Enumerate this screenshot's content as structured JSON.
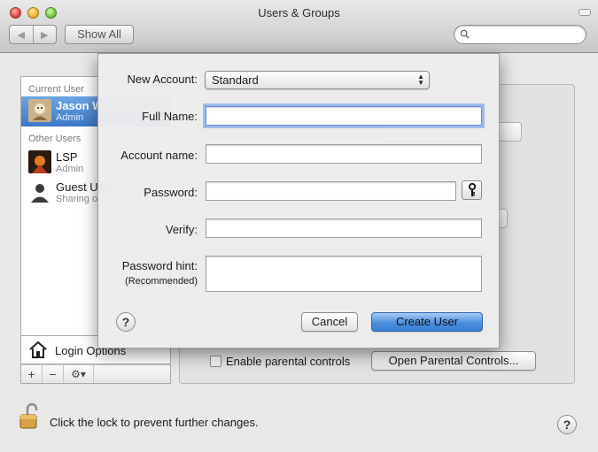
{
  "window": {
    "title": "Users & Groups",
    "show_all": "Show All",
    "search_placeholder": ""
  },
  "sidebar": {
    "current_user_header": "Current User",
    "other_users_header": "Other Users",
    "users": [
      {
        "name": "Jason W",
        "role": "Admin",
        "selected": true
      },
      {
        "name": "LSP",
        "role": "Admin",
        "selected": false
      },
      {
        "name": "Guest User",
        "role": "Sharing o",
        "selected": false
      }
    ],
    "login_options": "Login Options",
    "add_label": "+",
    "remove_label": "−",
    "gear_label": "⚙▾"
  },
  "panel": {
    "enable_parental_controls": "Enable parental controls",
    "parental_checked": false,
    "open_parental_controls": "Open Parental Controls..."
  },
  "footer": {
    "lock_text": "Click the lock to prevent further changes."
  },
  "sheet": {
    "new_account_label": "New Account:",
    "new_account_value": "Standard",
    "full_name_label": "Full Name:",
    "full_name_value": "",
    "account_name_label": "Account name:",
    "account_name_value": "",
    "password_label": "Password:",
    "password_value": "",
    "verify_label": "Verify:",
    "verify_value": "",
    "hint_label": "Password hint:",
    "hint_sublabel": "(Recommended)",
    "hint_value": "",
    "cancel": "Cancel",
    "create_user": "Create User",
    "help": "?"
  },
  "help_label": "?",
  "colors": {
    "selection": "#3b78c8",
    "default_button": "#4a8fe0",
    "focus_ring": "#5c8fd6"
  }
}
